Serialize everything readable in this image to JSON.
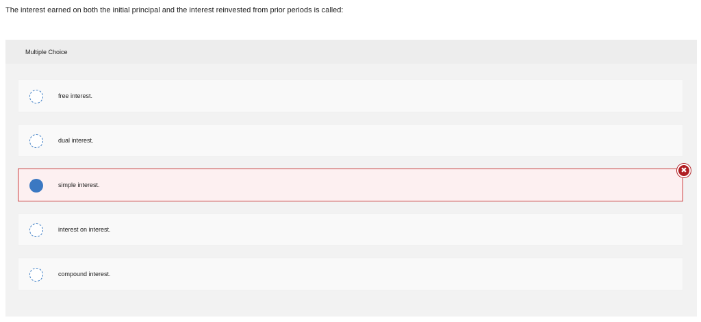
{
  "question": {
    "text": "The interest earned on both the initial principal and the interest reinvested from prior periods is called:"
  },
  "panel": {
    "title": "Multiple Choice"
  },
  "choices": [
    {
      "label": "free interest.",
      "selected": false
    },
    {
      "label": "dual interest.",
      "selected": false
    },
    {
      "label": "simple interest.",
      "selected": true,
      "result": "incorrect"
    },
    {
      "label": "interest on interest.",
      "selected": false
    },
    {
      "label": "compound interest.",
      "selected": false
    }
  ],
  "status": {
    "incorrect_icon": "x-mark-icon",
    "incorrect_glyph": "✖",
    "incorrect_color": "#b01e23"
  },
  "colors": {
    "radio_accent": "#3b78c2",
    "selected_border": "#c83c3c",
    "selected_background": "#fdf0f1"
  }
}
